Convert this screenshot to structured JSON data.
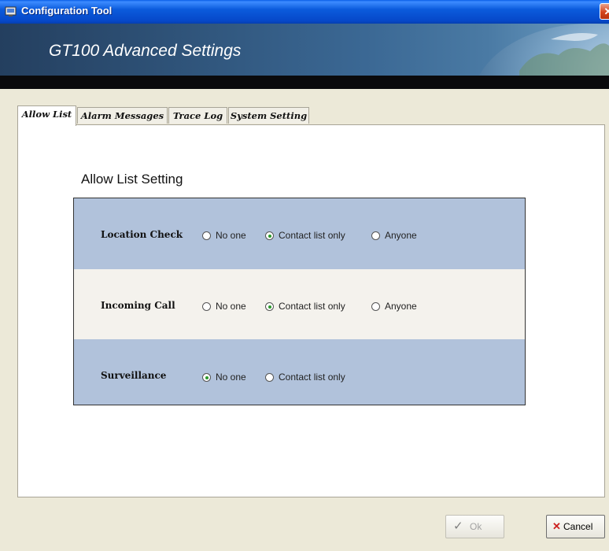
{
  "window": {
    "title": "Configuration Tool",
    "close_symbol": "✕"
  },
  "banner": {
    "title": "GT100 Advanced Settings"
  },
  "tabs": [
    {
      "label": "Allow List",
      "active": true
    },
    {
      "label": "Alarm Messages",
      "active": false
    },
    {
      "label": "Trace Log",
      "active": false
    },
    {
      "label": "System Setting",
      "active": false
    }
  ],
  "allow_list": {
    "section_title": "Allow List Setting",
    "rows": [
      {
        "label": "Location Check",
        "options": [
          "No one",
          "Contact list only",
          "Anyone"
        ],
        "selected": "Contact list only"
      },
      {
        "label": "Incoming Call",
        "options": [
          "No one",
          "Contact list only",
          "Anyone"
        ],
        "selected": "Contact list only"
      },
      {
        "label": "Surveillance",
        "options": [
          "No one",
          "Contact list only"
        ],
        "selected": "No one"
      }
    ]
  },
  "buttons": {
    "ok_label": "Ok",
    "ok_icon": "checkmark-icon",
    "ok_enabled": false,
    "cancel_label": "Cancel",
    "cancel_icon": "x-icon"
  },
  "colors": {
    "row_blue": "#b1c2db",
    "selected_radio": "#2b9a2b",
    "cancel_x": "#cc1f1f"
  }
}
